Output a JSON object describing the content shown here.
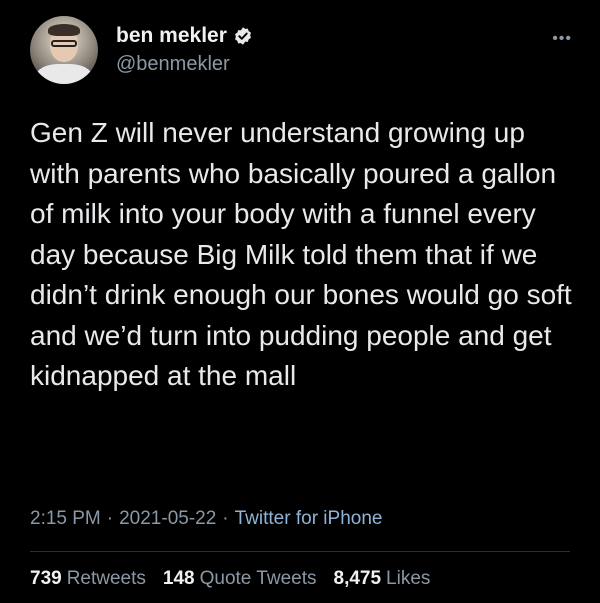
{
  "author": {
    "display_name": "ben mekler",
    "handle": "@benmekler",
    "verified": true
  },
  "menu_icon": "more-horizontal-icon",
  "tweet_text": "Gen Z will never understand growing up with parents who basically poured a gallon of milk into your body with a funnel every day because Big Milk told them that if we didn’t drink enough our bones would go soft and we’d turn into pudding people and get kidnapped at the mall",
  "meta": {
    "time": "2:15 PM",
    "date": "2021-05-22",
    "source": "Twitter for iPhone",
    "separator": "·"
  },
  "stats": {
    "retweets_count": "739",
    "retweets_label": "Retweets",
    "quote_count": "148",
    "quote_label": "Quote Tweets",
    "likes_count": "8,475",
    "likes_label": "Likes"
  },
  "colors": {
    "background": "#000000",
    "verified_badge": "#e7e9ea",
    "secondary_text": "#8b98a5"
  }
}
